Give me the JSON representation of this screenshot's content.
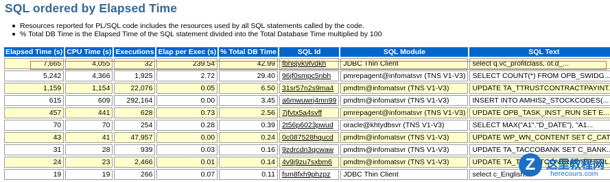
{
  "page": {
    "title": "SQL ordered by Elapsed Time",
    "notes": [
      "Resources reported for PL/SQL code includes the resources used by all SQL statements called by the code.",
      "% Total DB Time is the Elapsed Time of the SQL statement divided into the Total Database Time multiplied by 100"
    ]
  },
  "table": {
    "headers": [
      "Elapsed Time (s)",
      "CPU Time (s)",
      "Executions",
      "Elap per Exec (s)",
      "% Total DB Time",
      "SQL Id",
      "SQL Module",
      "SQL Text"
    ],
    "rows": [
      [
        "7,665",
        "4,055",
        "32",
        "239.54",
        "42.99",
        "fbh8jvk9fvdkh",
        "JDBC Thin Client",
        "select q.vc_profitclass, ot.d_..."
      ],
      [
        "5,242",
        "4,366",
        "1,925",
        "2.72",
        "29.40",
        "96jf0smpc5nbh",
        "pmrepagent@infomatsvr (TNS V1-V3)",
        "SELECT COUNT(*) FROM OPB_SWIDG..."
      ],
      [
        "1,159",
        "1,154",
        "22,076",
        "0.05",
        "6.50",
        "31sr57n2s9ma4",
        "pmdtm@infomatsvr (TNS V1-V3)",
        "UPDATE TA_TTRUSTCONTRACTPAYINT..."
      ],
      [
        "615",
        "609",
        "292,164",
        "0.00",
        "3.45",
        "a6mwuwrj4mn99",
        "pmdtm@infomatsvr (TNS V1-V3)",
        "INSERT INTO AMHIS2_STOCKCODES(..."
      ],
      [
        "457",
        "441",
        "628",
        "0.73",
        "2.56",
        "7jfvtx5a4svff",
        "pmrepagent@infomatsvr (TNS V1-V3)",
        "UPDATE OPB_TASK_INST_RUN SET E..."
      ],
      [
        "70",
        "70",
        "254",
        "0.28",
        "0.39",
        "2t56p6023pwud",
        "oracle@khtydbsvr (TNS V1-V3)",
        "SELECT MAX(\"A1\".\"D_DATE\"), \"A1..."
      ],
      [
        "43",
        "41",
        "47,957",
        "0.00",
        "0.24",
        "0c087528hqucd",
        "pmdtm@infomatsvr (TNS V1-V3)",
        "UPDATE WP_WN_CONTENT SET C_CAT..."
      ],
      [
        "31",
        "28",
        "939",
        "0.03",
        "0.16",
        "9zdrcdn3qcwaw",
        "pmdtm@infomatsvr (TNS V1-V3)",
        "UPDATE TA_TACCOBANK SET C_BANK..."
      ],
      [
        "24",
        "23",
        "2,466",
        "0.01",
        "0.14",
        "4v9j9zu7sxbm6",
        "pmdtm@infomatsvr (TNS V1-V3)",
        "UPDATE TA_TTRUSTCONTRACTDETAIL..."
      ],
      [
        "19",
        "19",
        "266",
        "0.07",
        "0.11",
        "fsm8fxh9phzpz",
        "JDBC Thin Client",
        "select c_English..."
      ]
    ]
  },
  "watermark": {
    "logo_letter": "Z",
    "title": "这里教程网",
    "subtitle": "herecours.com"
  },
  "colors": {
    "title": "#336699",
    "header_bg": "#0066cc",
    "odd_row_bg": "#ffffcc",
    "even_row_bg": "#ffffff",
    "sql_id_link": "#663300",
    "highlight_border": "#e06060",
    "watermark": "#1a6fc4"
  }
}
